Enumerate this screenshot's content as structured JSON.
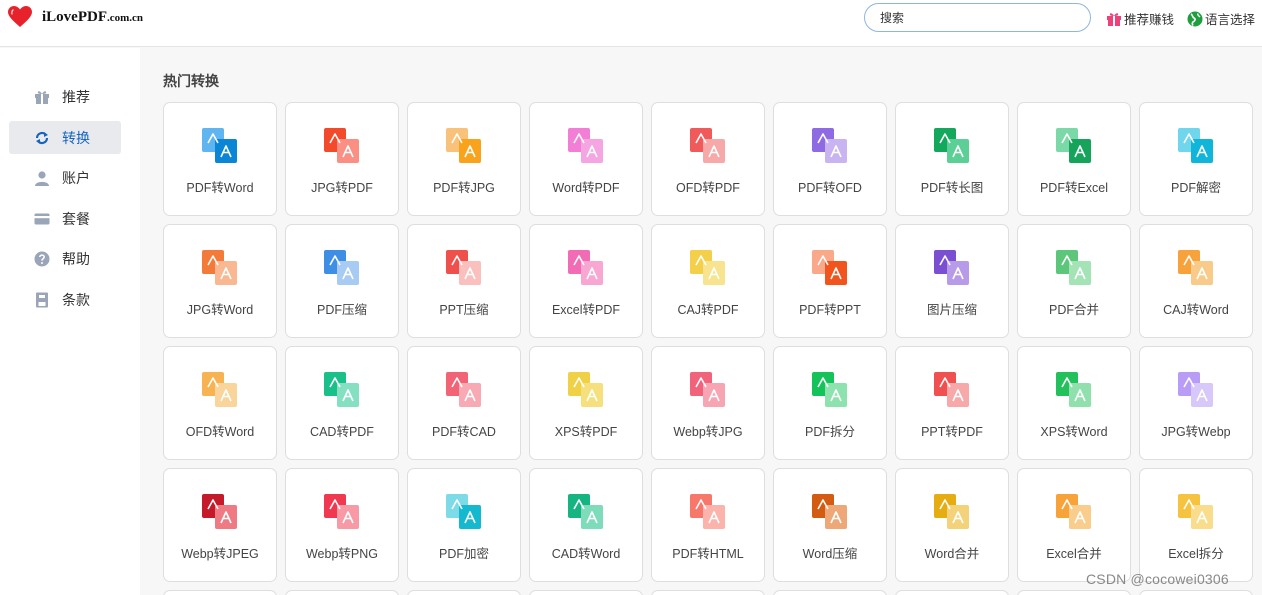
{
  "header": {
    "logo_main": "iLovePDF",
    "logo_suffix": ".com.cn",
    "search_placeholder": "搜索",
    "earn_label": "推荐赚钱",
    "lang_label": "语言选择"
  },
  "sidebar": {
    "items": [
      {
        "label": "推荐",
        "icon": "gift-icon",
        "active": false
      },
      {
        "label": "转换",
        "icon": "convert-icon",
        "active": true
      },
      {
        "label": "账户",
        "icon": "user-icon",
        "active": false
      },
      {
        "label": "套餐",
        "icon": "card-icon",
        "active": false
      },
      {
        "label": "帮助",
        "icon": "help-icon",
        "active": false
      },
      {
        "label": "条款",
        "icon": "terms-icon",
        "active": false
      }
    ]
  },
  "main": {
    "section_title": "热门转换",
    "tools": [
      {
        "label": "PDF转Word",
        "icon": "pdf-to-word-icon",
        "c1": "#5fb5f0",
        "c2": "#0b85d6"
      },
      {
        "label": "JPG转PDF",
        "icon": "jpg-to-pdf-icon",
        "c1": "#f24a2a",
        "c2": "#fb8f83"
      },
      {
        "label": "PDF转JPG",
        "icon": "pdf-to-jpg-icon",
        "c1": "#f9c27a",
        "c2": "#f9a21b"
      },
      {
        "label": "Word转PDF",
        "icon": "word-to-pdf-icon",
        "c1": "#f27ed6",
        "c2": "#f5a6e2"
      },
      {
        "label": "OFD转PDF",
        "icon": "ofd-to-pdf-icon",
        "c1": "#f05a5a",
        "c2": "#f7a8a8"
      },
      {
        "label": "PDF转OFD",
        "icon": "pdf-to-ofd-icon",
        "c1": "#8e6ae3",
        "c2": "#c9b4f2"
      },
      {
        "label": "PDF转长图",
        "icon": "pdf-to-long-image-icon",
        "c1": "#13a85c",
        "c2": "#5ccf96"
      },
      {
        "label": "PDF转Excel",
        "icon": "pdf-to-excel-icon",
        "c1": "#7ad9a6",
        "c2": "#16a35a"
      },
      {
        "label": "PDF解密",
        "icon": "pdf-decrypt-icon",
        "c1": "#6fd6ec",
        "c2": "#0fb6d9"
      },
      {
        "label": "JPG转Word",
        "icon": "jpg-to-word-icon",
        "c1": "#f47a3a",
        "c2": "#f9b891"
      },
      {
        "label": "PDF压缩",
        "icon": "pdf-compress-icon",
        "c1": "#3f8ee6",
        "c2": "#a8cbf3"
      },
      {
        "label": "PPT压缩",
        "icon": "ppt-compress-icon",
        "c1": "#f0504b",
        "c2": "#f9c0bd"
      },
      {
        "label": "Excel转PDF",
        "icon": "excel-to-pdf-icon",
        "c1": "#f26bb5",
        "c2": "#f7a7d1"
      },
      {
        "label": "CAJ转PDF",
        "icon": "caj-to-pdf-icon",
        "c1": "#f3cf4a",
        "c2": "#f8e38e"
      },
      {
        "label": "PDF转PPT",
        "icon": "pdf-to-ppt-icon",
        "c1": "#f9a98a",
        "c2": "#f2541d"
      },
      {
        "label": "图片压缩",
        "icon": "image-compress-icon",
        "c1": "#7b4fd1",
        "c2": "#b79be8"
      },
      {
        "label": "PDF合并",
        "icon": "pdf-merge-icon",
        "c1": "#5cc77a",
        "c2": "#a4e3b5"
      },
      {
        "label": "CAJ转Word",
        "icon": "caj-to-word-icon",
        "c1": "#f7a23a",
        "c2": "#f9cb8a"
      },
      {
        "label": "OFD转Word",
        "icon": "ofd-to-word-icon",
        "c1": "#f7b251",
        "c2": "#f9d49b"
      },
      {
        "label": "CAD转PDF",
        "icon": "cad-to-pdf-icon",
        "c1": "#19c08a",
        "c2": "#84e0c1"
      },
      {
        "label": "PDF转CAD",
        "icon": "pdf-to-cad-icon",
        "c1": "#f26376",
        "c2": "#f7aab4"
      },
      {
        "label": "XPS转PDF",
        "icon": "xps-to-pdf-icon",
        "c1": "#f0d045",
        "c2": "#f6e07d"
      },
      {
        "label": "Webp转JPG",
        "icon": "webp-to-jpg-icon",
        "c1": "#f0637b",
        "c2": "#f7a5b3"
      },
      {
        "label": "PDF拆分",
        "icon": "pdf-split-icon",
        "c1": "#14c45a",
        "c2": "#8de2ae"
      },
      {
        "label": "PPT转PDF",
        "icon": "ppt-to-pdf-icon",
        "c1": "#f05050",
        "c2": "#f7a9a9"
      },
      {
        "label": "XPS转Word",
        "icon": "xps-to-word-icon",
        "c1": "#22c15c",
        "c2": "#8fe0ad"
      },
      {
        "label": "JPG转Webp",
        "icon": "jpg-to-webp-icon",
        "c1": "#b89cf5",
        "c2": "#d8c8fa"
      },
      {
        "label": "Webp转JPEG",
        "icon": "webp-to-jpeg-icon",
        "c1": "#c51a2a",
        "c2": "#f07a84"
      },
      {
        "label": "Webp转PNG",
        "icon": "webp-to-png-icon",
        "c1": "#f03850",
        "c2": "#f79aa6"
      },
      {
        "label": "PDF加密",
        "icon": "pdf-encrypt-icon",
        "c1": "#7ddbe7",
        "c2": "#14b9cf"
      },
      {
        "label": "CAD转Word",
        "icon": "cad-to-word-icon",
        "c1": "#16b480",
        "c2": "#7fdcbb"
      },
      {
        "label": "PDF转HTML",
        "icon": "pdf-to-html-icon",
        "c1": "#f7786a",
        "c2": "#fab4ab"
      },
      {
        "label": "Word压缩",
        "icon": "word-compress-icon",
        "c1": "#d45b12",
        "c2": "#eea776"
      },
      {
        "label": "Word合并",
        "icon": "word-merge-icon",
        "c1": "#e6ad12",
        "c2": "#f3d27a"
      },
      {
        "label": "Excel合并",
        "icon": "excel-merge-icon",
        "c1": "#f7a33a",
        "c2": "#f9cd8c"
      },
      {
        "label": "Excel拆分",
        "icon": "excel-split-icon",
        "c1": "#f6c340",
        "c2": "#f9dd8c"
      }
    ]
  },
  "watermark": "CSDN @cocowei0306",
  "colors": {
    "accent": "#1565c0",
    "brand_red": "#e8222a",
    "search_border": "#8fb6e0"
  }
}
